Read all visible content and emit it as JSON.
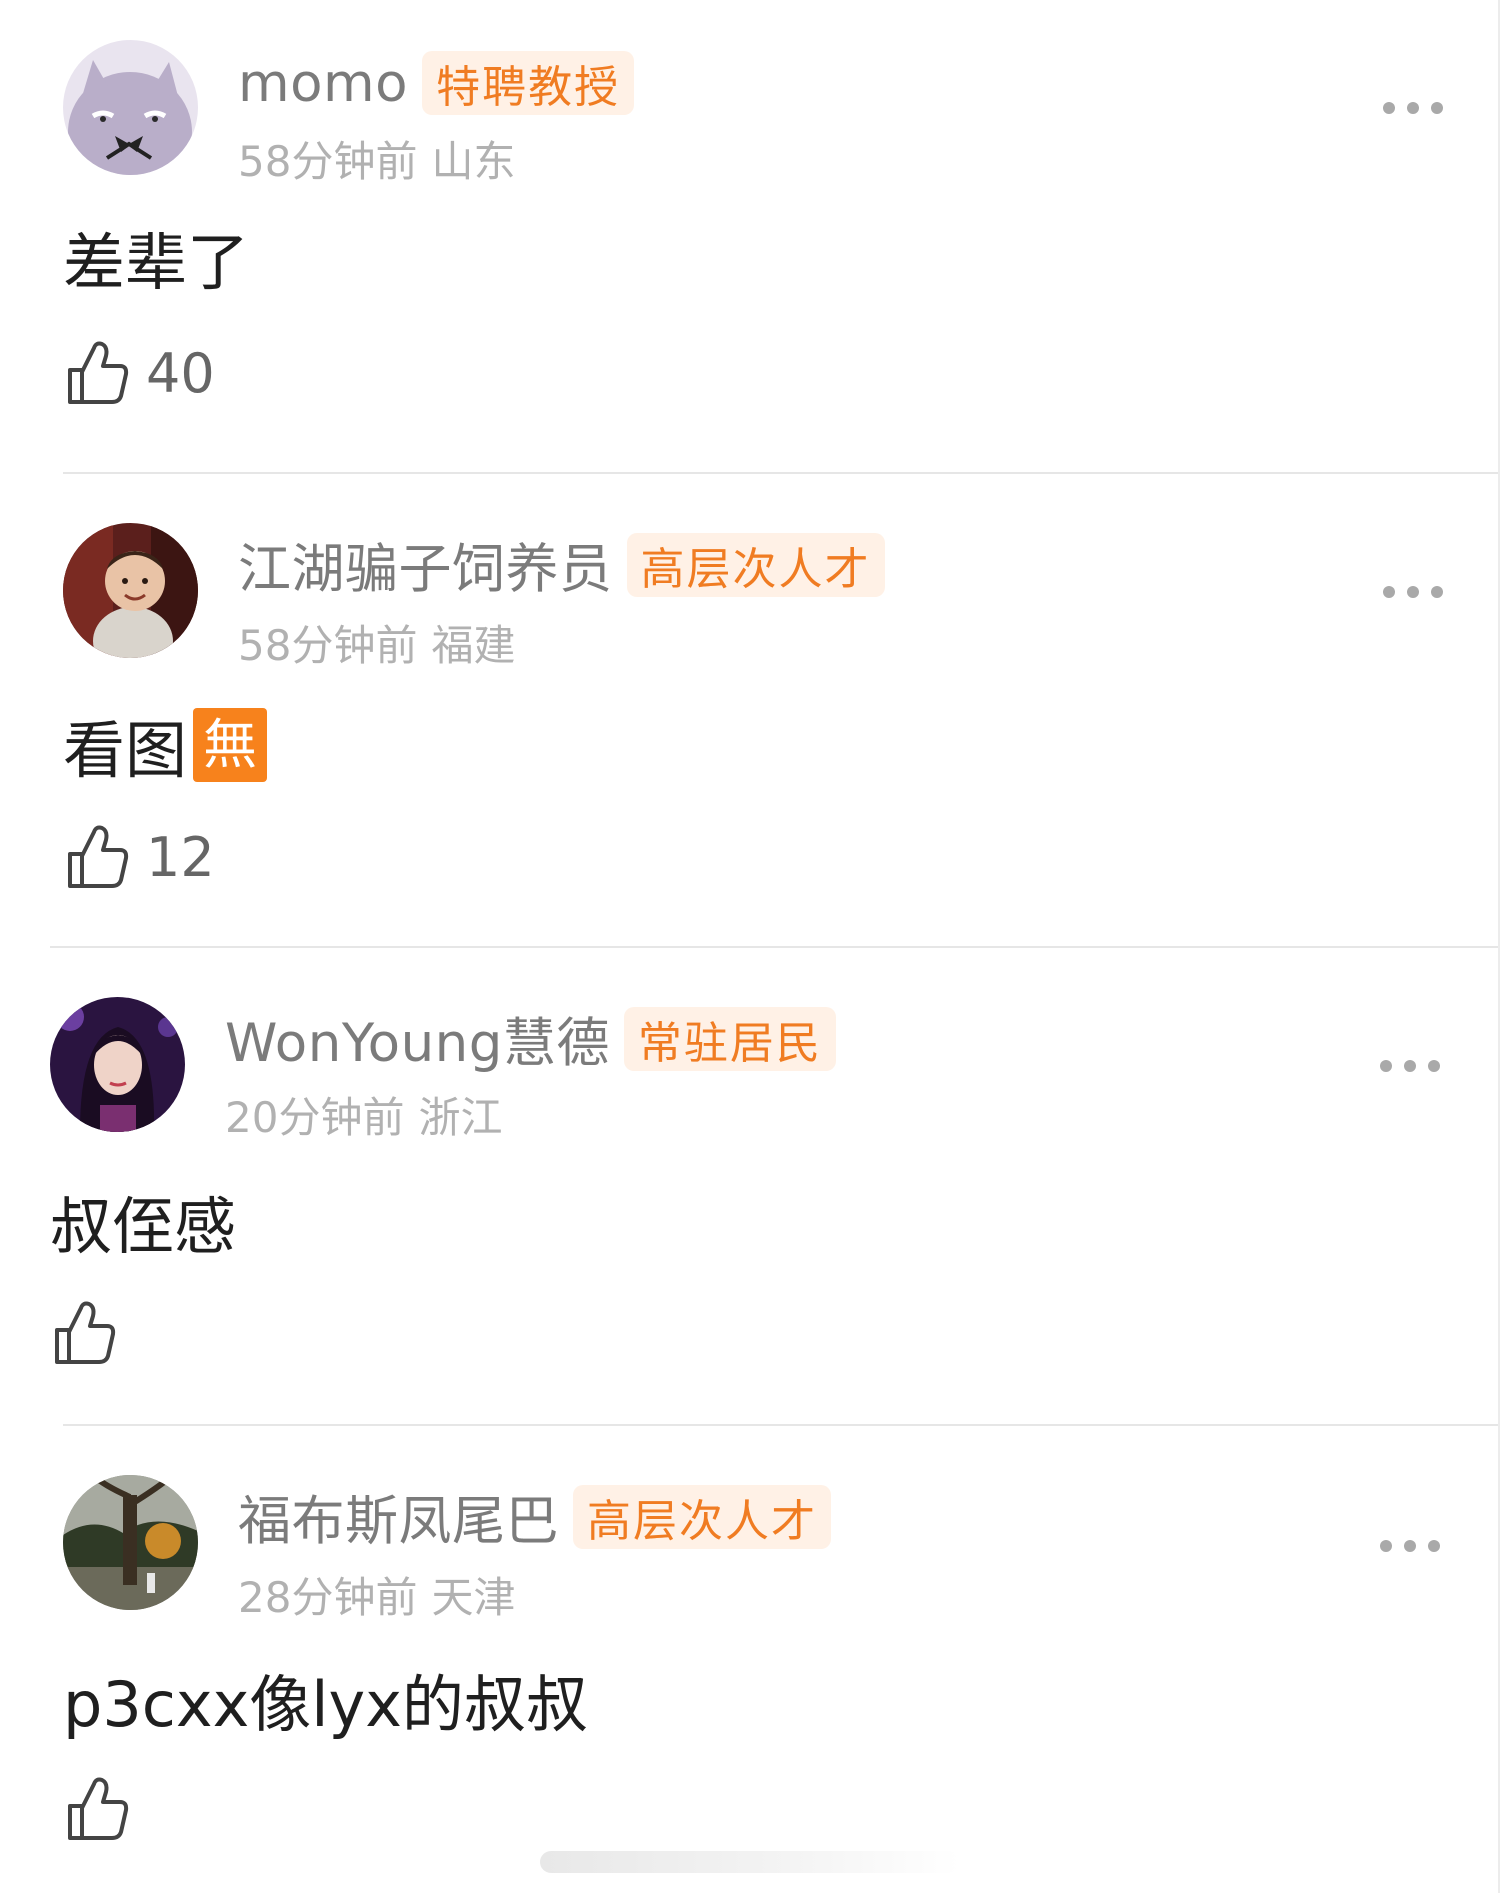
{
  "comments": [
    {
      "username": "momo",
      "badge": "特聘教授",
      "time": "58分钟前",
      "location": "山东",
      "text": "差辈了",
      "likes": "40",
      "avatar_icon": "cartoon-cat-avatar"
    },
    {
      "username": "江湖骗子饲养员",
      "badge": "高层次人才",
      "time": "58分钟前",
      "location": "福建",
      "text": "看图",
      "emoji": "無",
      "likes": "12",
      "avatar_icon": "toddler-photo-avatar"
    },
    {
      "username": "WonYoung慧德",
      "badge": "常驻居民",
      "time": "20分钟前",
      "location": "浙江",
      "text": "叔侄感",
      "likes": "",
      "avatar_icon": "idol-photo-avatar"
    },
    {
      "username": "福布斯凤尾巴",
      "badge": "高层次人才",
      "time": "28分钟前",
      "location": "天津",
      "text": "p3cxx像lyx的叔叔",
      "likes": "",
      "avatar_icon": "tree-photo-avatar"
    }
  ],
  "colors": {
    "badge_text": "#f07c22",
    "badge_bg": "#fff1e6",
    "username": "#7b7b7b",
    "meta": "#b1b1b1",
    "emoji_bg": "#f7821c"
  }
}
